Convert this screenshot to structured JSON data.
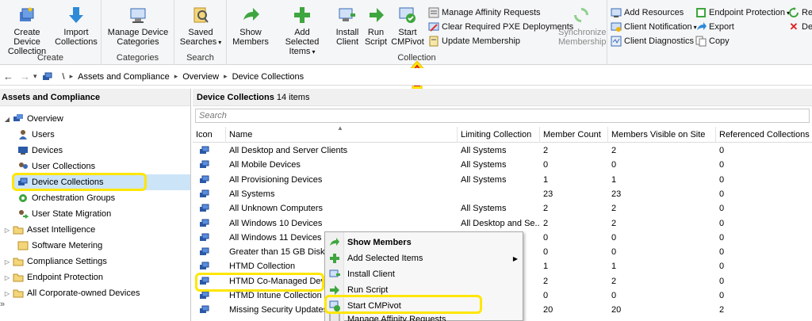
{
  "ribbon": {
    "groups": {
      "create": "Create",
      "categories": "Categories",
      "search": "Search",
      "collection": "Collection"
    },
    "create_device_collection": [
      "Create Device",
      "Collection"
    ],
    "import_collections": [
      "Import",
      "Collections"
    ],
    "manage_device_categories": [
      "Manage Device",
      "Categories"
    ],
    "saved_searches": [
      "Saved",
      "Searches"
    ],
    "show_members": [
      "Show",
      "Members"
    ],
    "add_selected_items": [
      "Add",
      "Selected Items"
    ],
    "install_client": [
      "Install",
      "Client"
    ],
    "run_script": [
      "Run",
      "Script"
    ],
    "start_cmpivot": [
      "Start",
      "CMPivot"
    ],
    "manage_affinity_requests": "Manage Affinity Requests",
    "clear_pxe": "Clear Required PXE Deployments",
    "update_membership": "Update Membership",
    "synchronize_membership": [
      "Synchronize",
      "Membership"
    ],
    "add_resources": "Add Resources",
    "client_notification": "Client Notification",
    "client_diagnostics": "Client Diagnostics",
    "endpoint_protection": "Endpoint Protection",
    "export": "Export",
    "copy": "Copy",
    "refresh": "Ref",
    "delete": "Del"
  },
  "address": {
    "root": "\\",
    "crumbs": [
      "Assets and Compliance",
      "Overview",
      "Device Collections"
    ]
  },
  "leftnav": {
    "header": "Assets and Compliance",
    "items": [
      {
        "label": "Overview",
        "icon": "overview-icon"
      },
      {
        "label": "Users",
        "icon": "user-icon"
      },
      {
        "label": "Devices",
        "icon": "device-icon"
      },
      {
        "label": "User Collections",
        "icon": "user-collection-icon"
      },
      {
        "label": "Device Collections",
        "icon": "device-collection-icon"
      },
      {
        "label": "Orchestration Groups",
        "icon": "orchestration-icon"
      },
      {
        "label": "User State Migration",
        "icon": "migration-icon"
      },
      {
        "label": "Asset Intelligence",
        "icon": "folder-icon"
      },
      {
        "label": "Software Metering",
        "icon": "metering-icon"
      },
      {
        "label": "Compliance Settings",
        "icon": "folder-icon"
      },
      {
        "label": "Endpoint Protection",
        "icon": "folder-icon"
      },
      {
        "label": "All Corporate-owned Devices",
        "icon": "folder-icon"
      }
    ]
  },
  "main": {
    "title": "Device Collections",
    "count": "14 items",
    "search_placeholder": "Search",
    "columns": [
      "Icon",
      "Name",
      "Limiting Collection",
      "Member Count",
      "Members Visible on Site",
      "Referenced Collections"
    ],
    "rows": [
      [
        "All Desktop and Server Clients",
        "All Systems",
        "2",
        "2",
        "0"
      ],
      [
        "All Mobile Devices",
        "All Systems",
        "0",
        "0",
        "0"
      ],
      [
        "All Provisioning Devices",
        "All Systems",
        "1",
        "1",
        "0"
      ],
      [
        "All Systems",
        "",
        "23",
        "23",
        "0"
      ],
      [
        "All Unknown Computers",
        "All Systems",
        "2",
        "2",
        "0"
      ],
      [
        "All Windows 10 Devices",
        "All Desktop and Se...",
        "2",
        "2",
        "0"
      ],
      [
        "All Windows 11 Devices",
        "",
        "0",
        "0",
        "0"
      ],
      [
        "Greater than 15 GB Disk Sp",
        "",
        "0",
        "0",
        "0"
      ],
      [
        "HTMD Collection",
        "",
        "1",
        "1",
        "0"
      ],
      [
        "HTMD Co-Managed Devic",
        "",
        "2",
        "2",
        "0"
      ],
      [
        "HTMD Intune Collection",
        "",
        "0",
        "0",
        "0"
      ],
      [
        "Missing Security Updates",
        "",
        "20",
        "20",
        "2"
      ]
    ]
  },
  "context_menu": {
    "items": [
      {
        "label": "Show Members",
        "icon": "show-members-icon"
      },
      {
        "label": "Add Selected Items",
        "icon": "add-icon"
      },
      {
        "label": "Install Client",
        "icon": "install-client-icon"
      },
      {
        "label": "Run Script",
        "icon": "run-script-icon"
      },
      {
        "label": "Start CMPivot",
        "icon": "cmpivot-icon"
      },
      {
        "label": "Manage Affinity Requests",
        "icon": "affinity-icon"
      }
    ]
  },
  "colors": {
    "accent_green": "#3ea63e",
    "highlight_yellow": "#ffe600",
    "selection_blue": "#cce4f7",
    "arrow_red": "#e02020"
  }
}
